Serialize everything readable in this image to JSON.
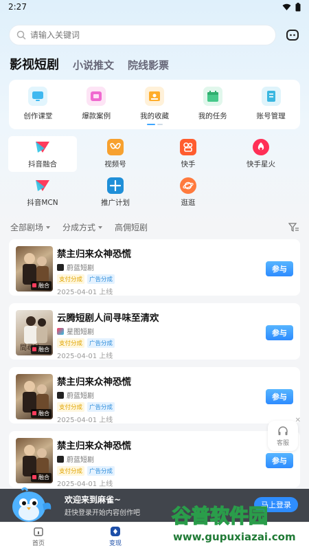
{
  "status": {
    "time": "2:27"
  },
  "search": {
    "placeholder": "请输入关键词"
  },
  "tabs": [
    {
      "label": "影视短剧"
    },
    {
      "label": "小说推文"
    },
    {
      "label": "院线影票"
    }
  ],
  "quick_actions": [
    {
      "label": "创作课堂",
      "icon": "monitor-icon",
      "color": "#3fb8f0"
    },
    {
      "label": "爆款案例",
      "icon": "video-icon",
      "color": "#f06ad0"
    },
    {
      "label": "我的收藏",
      "icon": "image-icon",
      "color": "#ffad2b"
    },
    {
      "label": "我的任务",
      "icon": "calendar-icon",
      "color": "#46c98a"
    },
    {
      "label": "账号管理",
      "icon": "book-icon",
      "color": "#3ab7e0"
    }
  ],
  "platforms": [
    {
      "label": "抖音融合",
      "icon": "douyin-icon"
    },
    {
      "label": "视频号",
      "icon": "channels-icon"
    },
    {
      "label": "快手",
      "icon": "kuaishou-icon"
    },
    {
      "label": "快手星火",
      "icon": "fire-icon"
    },
    {
      "label": "抖音MCN",
      "icon": "douyin-mcn-icon"
    },
    {
      "label": "推广计划",
      "icon": "plan-icon"
    },
    {
      "label": "逛逛",
      "icon": "planet-icon"
    }
  ],
  "filters": [
    {
      "label": "全部剧场"
    },
    {
      "label": "分成方式"
    },
    {
      "label": "高佣短剧"
    }
  ],
  "dramas": [
    {
      "title": "禁主归来众神恐慌",
      "platform": "蔚蓝短剧",
      "badge1": "支付分成",
      "badge2": "广告分成",
      "date": "2025-04-01 上线",
      "tag": "融合",
      "join": "参与"
    },
    {
      "title": "云腾短剧人间寻味至清欢",
      "platform": "星图短剧",
      "badge1": "支付分成",
      "badge2": "广告分成",
      "date": "2025-04-01 上线",
      "tag": "融合",
      "join": "参与"
    },
    {
      "title": "禁主归来众神恐慌",
      "platform": "蔚蓝短剧",
      "badge1": "支付分成",
      "badge2": "广告分成",
      "date": "2025-04-01 上线",
      "tag": "融合",
      "join": "参与"
    },
    {
      "title": "禁主归来众神恐慌",
      "platform": "蔚蓝短剧",
      "badge1": "支付分成",
      "badge2": "广告分成",
      "date": "2025-04-01 上线",
      "tag": "融合",
      "join": "参与"
    }
  ],
  "service": {
    "label": "客服"
  },
  "banner": {
    "title": "欢迎来到麻雀~",
    "subtitle": "赶快登录开始内容创作吧",
    "button": "马上登录"
  },
  "watermark": {
    "text": "谷普软件园",
    "url": "www.gupuxiazai.com"
  },
  "nav": [
    {
      "label": "首页"
    },
    {
      "label": "变现"
    }
  ]
}
